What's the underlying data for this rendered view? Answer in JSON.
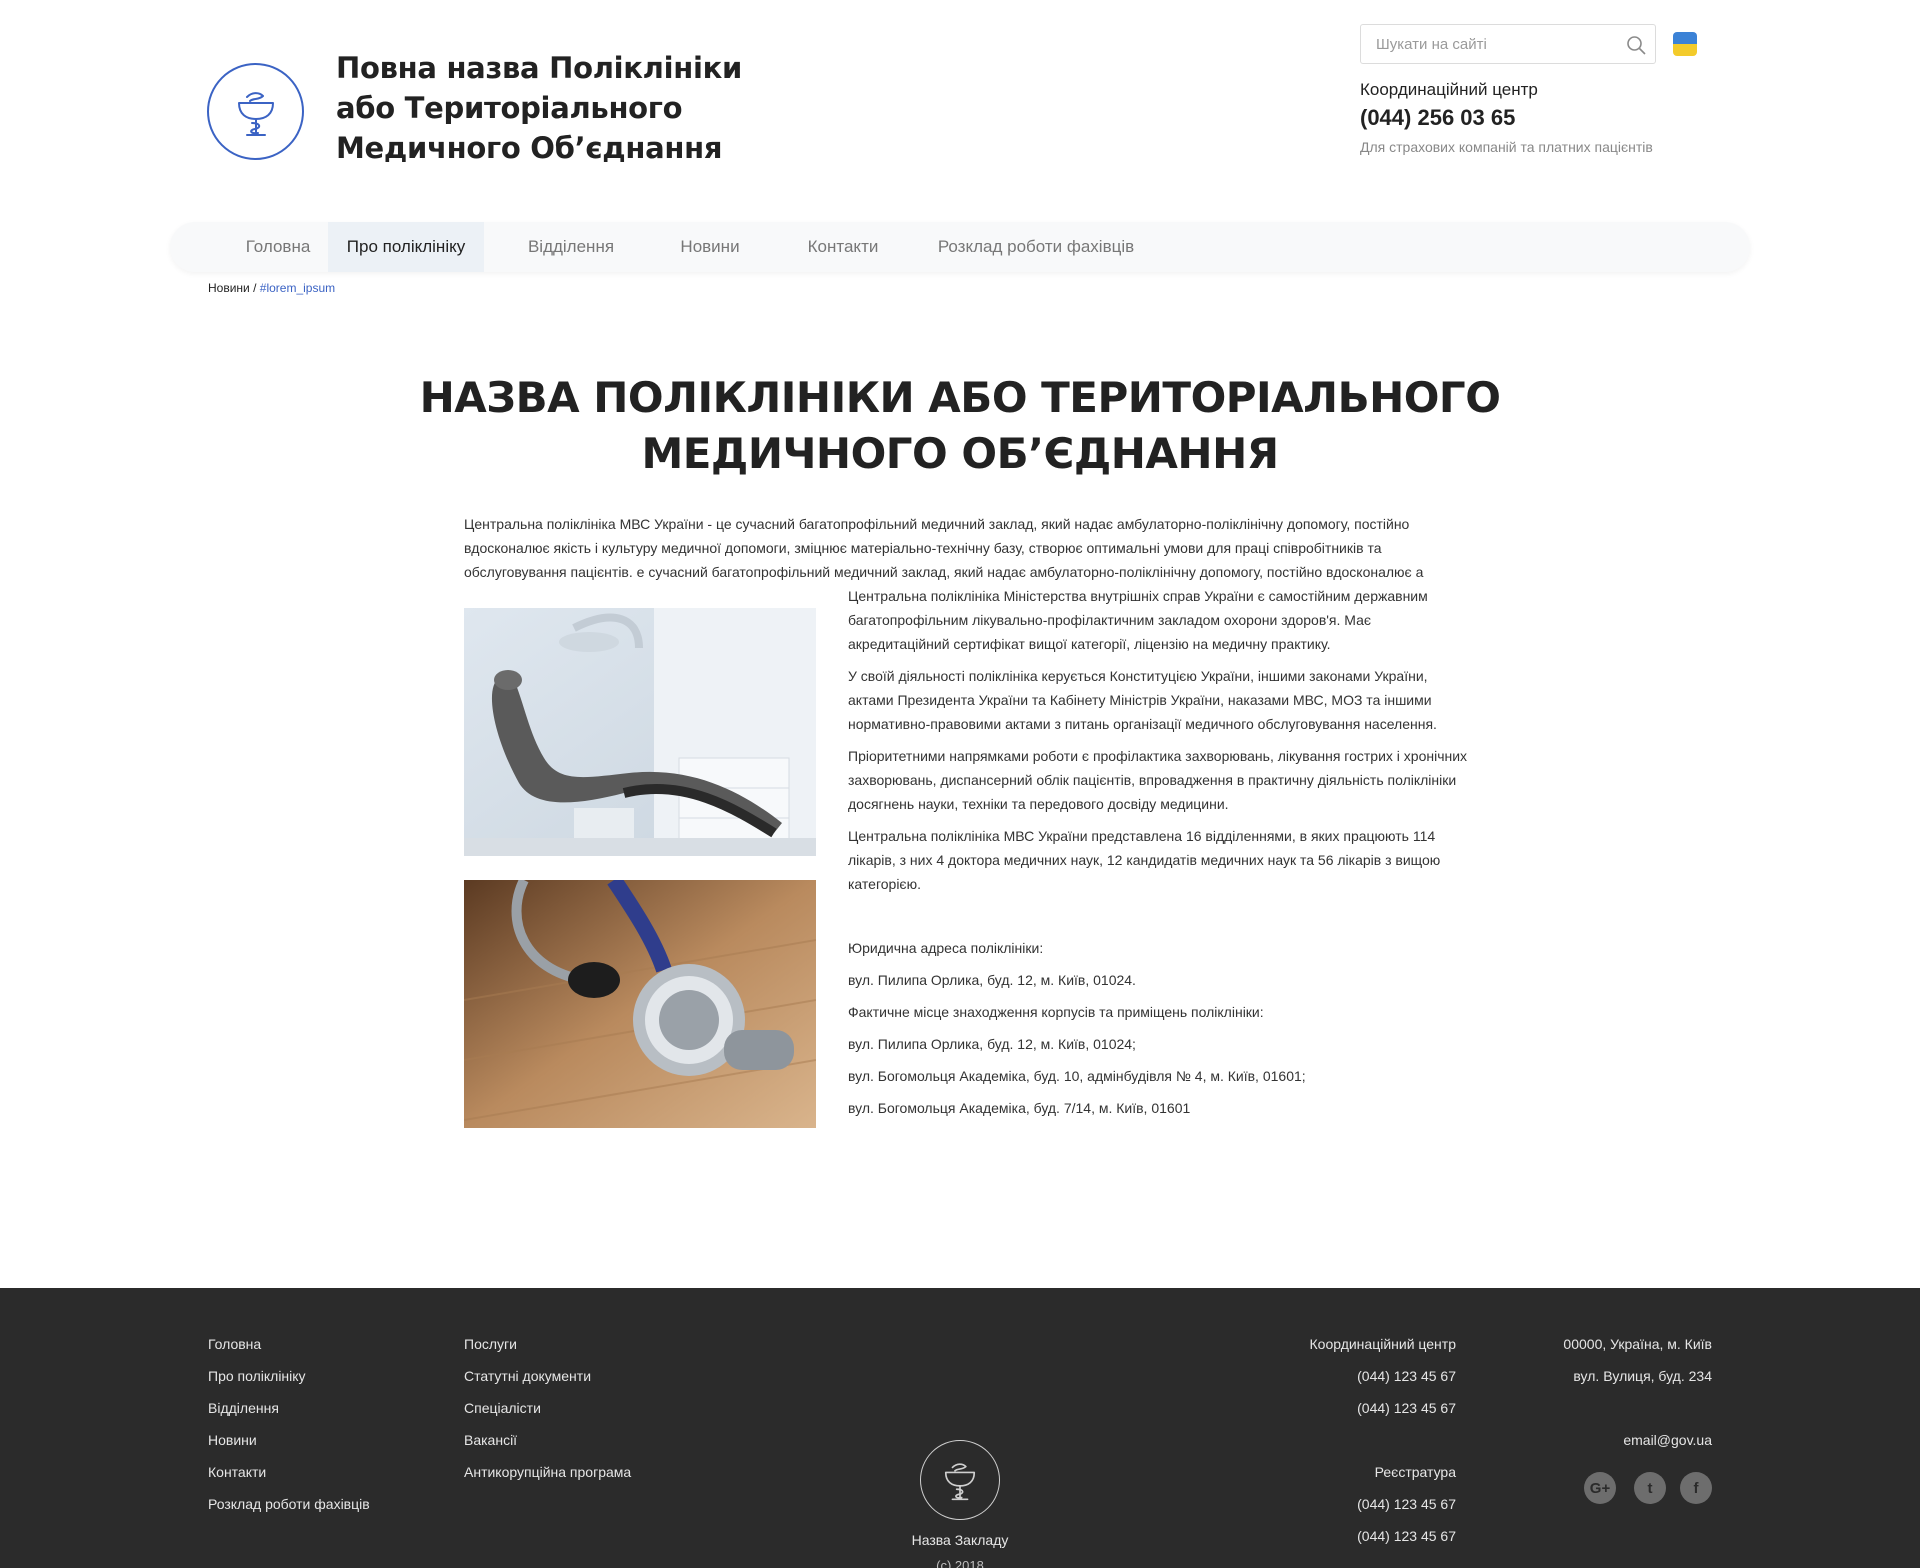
{
  "header": {
    "site_title": "Повна назва Поліклініки або Територіального Медичного Об’єднання",
    "search_placeholder": "Шукати на сайті",
    "contact_label": "Координаційний центр",
    "contact_phone": "(044) 256 03 65",
    "contact_note": "Для страхових компаній та платних пацієнтів",
    "flag": {
      "top_color": "#3b82d6",
      "bottom_color": "#f3cb2b"
    }
  },
  "nav": {
    "items": [
      {
        "label": "Головна",
        "active": false
      },
      {
        "label": "Про поліклініку",
        "active": true
      },
      {
        "label": "Відділення",
        "active": false
      },
      {
        "label": "Новини",
        "active": false
      },
      {
        "label": "Контакти",
        "active": false
      },
      {
        "label": "Розклад роботи фахівців",
        "active": false
      }
    ]
  },
  "breadcrumb": {
    "parent": "Новини",
    "separator": " / ",
    "current": "#lorem_ipsum"
  },
  "main": {
    "title": "НАЗВА ПОЛІКЛІНІКИ АБО ТЕРИТОРІАЛЬНОГО МЕДИЧНОГО ОБ’ЄДНАННЯ",
    "intro": "Центральна поліклініка МВС України - це сучасний багатопрофільний медичний заклад, який надає амбулаторно-поліклінічну допомогу, постійно вдосконалює якість і культуру медичної допомоги, зміцнює матеріально-технічну базу, створює оптимальні умови для праці співробітників та обслуговування пацієнтів. е сучасний багатопрофільний медичний заклад, який надає амбулаторно-поліклінічну допомогу, постійно вдосконалює а",
    "paragraphs": [
      "Центральна поліклініка Міністерства внутрішніх справ України є самостійним державним багатопрофільним лікувально-профілактичним закладом охорони здоров'я. Має акредитаційний сертифікат вищої категорії, ліцензію на медичну практику.",
      "У своїй діяльності поліклініка керується Конституцією України, іншими законами України, актами Президента України та Кабінету Міністрів України, наказами МВС, МОЗ та іншими нормативно-правовими актами з питань організації медичного обслуговування населення.",
      "Пріоритетними напрямками роботи є профілактика захворювань, лікування гострих і хронічних захворювань, диспансерний облік пацієнтів, впровадження в практичну діяльність поліклініки досягнень науки, техніки та передового досвіду медицини.",
      "Центральна поліклініка МВС України представлена 16 відділеннями, в яких працюють 114 лікарів, з них 4 доктора медичних наук, 12 кандидатів медичних наук та 56 лікарів з вищою категорією."
    ],
    "address_lines": [
      "Юридична адреса поліклініки:",
      "вул. Пилипа Орлика, буд. 12, м. Київ, 01024.",
      "Фактичне місце знаходження корпусів та приміщень поліклініки:",
      "вул. Пилипа Орлика, буд. 12, м. Київ, 01024;",
      "вул. Богомольця Академіка, буд. 10, адмінбудівля № 4, м. Київ, 01601;",
      "вул. Богомольця Академіка, буд. 7/14, м. Київ, 01601"
    ]
  },
  "footer": {
    "col1": [
      "Головна",
      "Про поліклініку",
      "Відділення",
      "Новини",
      "Контакти",
      "Розклад роботи фахівців"
    ],
    "col2": [
      "Послуги",
      "Статутні документи",
      "Спеціалісти",
      "Вакансії",
      "Антикорупційна програма"
    ],
    "coord_label": "Координаційний центр",
    "coord_phones": [
      "(044) 123 45 67",
      "(044) 123 45 67"
    ],
    "registry_label": "Реєстратура",
    "registry_phones": [
      "(044) 123 45 67",
      "(044) 123 45 67"
    ],
    "address_lines": [
      "00000, Україна, м. Київ",
      "вул. Вулиця, буд. 234"
    ],
    "email": "email@gov.ua",
    "social": [
      {
        "icon": "google-plus-icon",
        "glyph": "G+"
      },
      {
        "icon": "twitter-icon",
        "glyph": "t"
      },
      {
        "icon": "facebook-icon",
        "glyph": "f"
      }
    ],
    "institution_name": "Назва Закладу",
    "year": "(с) 2018"
  }
}
